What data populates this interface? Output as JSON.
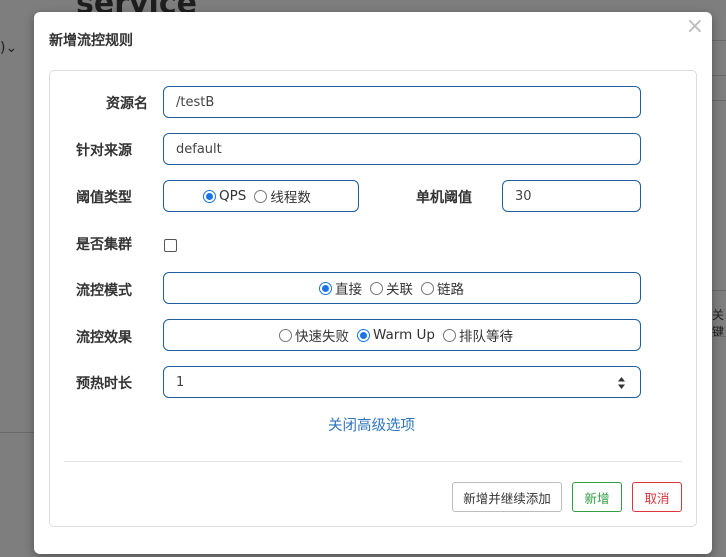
{
  "background": {
    "title": "service",
    "left_text": ")⌄",
    "right_text": "关键"
  },
  "dialog": {
    "title": "新增流控规则",
    "close": "×"
  },
  "form": {
    "resource": {
      "label": "资源名",
      "value": "/testB"
    },
    "limit_app": {
      "label": "针对来源",
      "value": "default"
    },
    "grade": {
      "label": "阈值类型",
      "options": [
        "QPS",
        "线程数"
      ],
      "selected": "QPS"
    },
    "count": {
      "label": "单机阈值",
      "value": "30"
    },
    "cluster": {
      "label": "是否集群",
      "checked": false
    },
    "strategy": {
      "label": "流控模式",
      "options": [
        "直接",
        "关联",
        "链路"
      ],
      "selected": "直接"
    },
    "control_behavior": {
      "label": "流控效果",
      "options": [
        "快速失败",
        "Warm Up",
        "排队等待"
      ],
      "selected": "Warm Up"
    },
    "warmup_sec": {
      "label": "预热时长",
      "value": "1"
    },
    "advanced_toggle": "关闭高级选项"
  },
  "footer": {
    "add_continue": "新增并继续添加",
    "add": "新增",
    "cancel": "取消"
  },
  "colors": {
    "accent": "#1a73e8",
    "input_border": "#1f5fa0",
    "link": "#2e75c0",
    "success": "#2f9e44",
    "danger": "#d9363e"
  }
}
